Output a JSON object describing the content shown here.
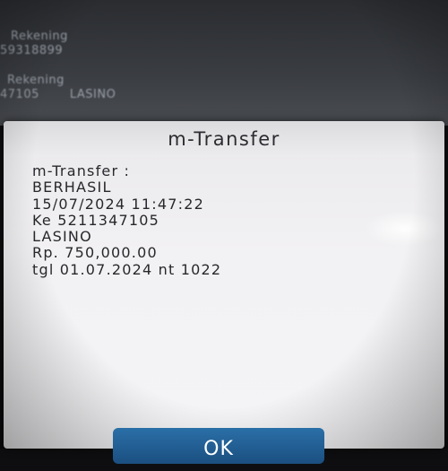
{
  "background": {
    "row1": "Rekening",
    "row2": "59318899",
    "row3": "Rekening",
    "row4_account": "47105",
    "row4_name": "LASINO"
  },
  "dialog": {
    "title": "m-Transfer",
    "lines": [
      "m-Transfer :",
      "BERHASIL",
      "15/07/2024  11:47:22",
      "Ke  5211347105",
      "LASINO",
      "Rp.  750,000.00",
      "tgl  01.07.2024  nt  1022"
    ],
    "ok_label": "OK"
  },
  "colors": {
    "dialog_bg": "#f2f1f3",
    "button": "#1f5a8e",
    "text": "#28282c"
  }
}
